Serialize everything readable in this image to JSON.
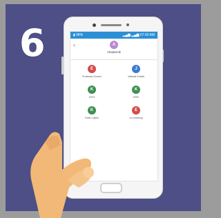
{
  "step_number": "6",
  "status_bar": {
    "left_text": "▮ 98%",
    "right_text": "▂▄▆ ▂▄▆ 07:00 AM"
  },
  "app_bar": {
    "back_icon": "chevron-left",
    "avatar_letter": "A",
    "avatar_color": "#b98ad1",
    "title": "Akademik"
  },
  "menu_items": [
    {
      "letter": "E",
      "label": "Evaluasi Dosen",
      "color": "#d64a4a"
    },
    {
      "letter": "J",
      "label": "Jadwal Kuliah",
      "color": "#3d7bd1"
    },
    {
      "letter": "K",
      "label": "KHS",
      "color": "#3e8f54"
    },
    {
      "letter": "K",
      "label": "KRS",
      "color": "#3e8f54"
    },
    {
      "letter": "K",
      "label": "Kartu Ujian",
      "color": "#3e8f54"
    },
    {
      "letter": "E",
      "label": "e-Learning",
      "color": "#d64a4a"
    }
  ],
  "colors": {
    "background": "#4d4f86",
    "status_bar": "#2a8fd4",
    "hand": "#f2b877"
  }
}
